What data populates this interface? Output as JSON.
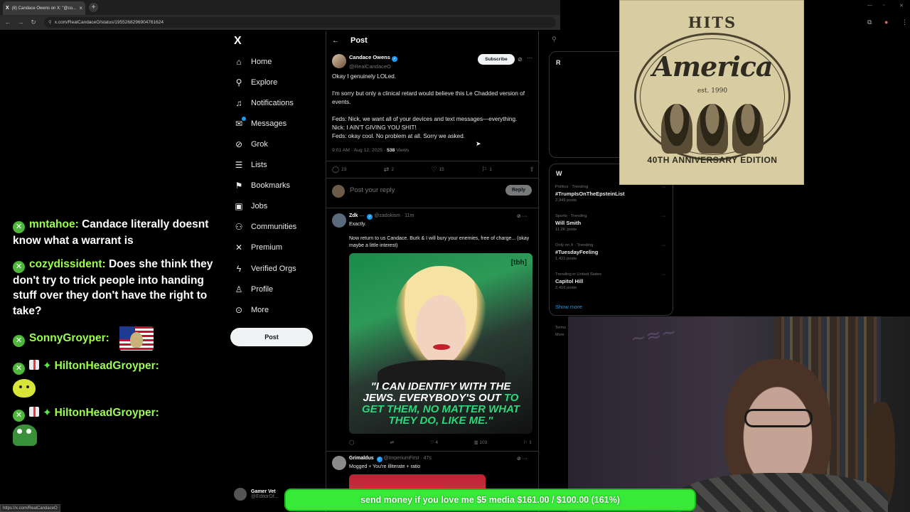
{
  "browser": {
    "tab_title": "(8) Candace Owens on X: \"@co...",
    "url": "x.com/RealCandaceO/status/1955268296904761624"
  },
  "chat": {
    "messages": [
      {
        "user": "mntahoe:",
        "text": "Candace literally doesnt know what a warrant is"
      },
      {
        "user": "cozydissident:",
        "text": "Does she think they don't try to trick people into handing stuff over they don't have the right to take?"
      },
      {
        "user": "SonnyGroyper:",
        "text": ""
      },
      {
        "user": "HiltonHeadGroyper:",
        "text": ""
      },
      {
        "user": "HiltonHeadGroyper:",
        "text": ""
      }
    ]
  },
  "nav": {
    "logo": "X",
    "items": [
      {
        "label": "Home",
        "icon": "home-icon"
      },
      {
        "label": "Explore",
        "icon": "search-icon"
      },
      {
        "label": "Notifications",
        "icon": "bell-icon"
      },
      {
        "label": "Messages",
        "icon": "mail-icon"
      },
      {
        "label": "Grok",
        "icon": "grok-icon"
      },
      {
        "label": "Lists",
        "icon": "list-icon"
      },
      {
        "label": "Bookmarks",
        "icon": "bookmark-icon"
      },
      {
        "label": "Jobs",
        "icon": "briefcase-icon"
      },
      {
        "label": "Communities",
        "icon": "people-icon"
      },
      {
        "label": "Premium",
        "icon": "x-icon"
      },
      {
        "label": "Verified Orgs",
        "icon": "lightning-icon"
      },
      {
        "label": "Profile",
        "icon": "person-icon"
      },
      {
        "label": "More",
        "icon": "more-circle-icon"
      }
    ],
    "post_button": "Post",
    "account": {
      "name": "Gamer Vet",
      "handle": "@EditorOf..."
    }
  },
  "post": {
    "header": "Post",
    "author": "Candace Owens",
    "handle": "@RealCandaceO",
    "subscribe": "Subscribe",
    "paragraphs": [
      "Okay I genuinely LOLed.",
      "I'm sorry but only a clinical retard would believe this Le Chadded version of events."
    ],
    "dialogue": [
      "Feds: Nick, we want all of your devices and text messages—everything.",
      "Nick: I AIN'T GIVING YOU SHIT!",
      "Feds: okay cool. No problem at all. Sorry we asked."
    ],
    "time": "9:01 AM · Aug 12, 2025 ·",
    "views_count": "538",
    "views_label": "Views",
    "stats": {
      "replies": "23",
      "reposts": "2",
      "likes": "15",
      "bookmarks": "1"
    }
  },
  "reply_box": {
    "placeholder": "Post your reply",
    "button": "Reply"
  },
  "replies": [
    {
      "name": "Zdk",
      "handle": "@zadokism · 11m",
      "text": "Exactly.",
      "text2": "Now return to us Candace. Burk & I will bury your enemies, free of charge... (okay maybe a little interest)",
      "image": {
        "tag": "[tbh]",
        "quote_white": "\"I CAN IDENTIFY WITH THE JEWS. EVERYBODY'S OUT",
        "quote_green": "TO GET THEM, NO MATTER WHAT THEY DO, LIKE ME.\""
      },
      "stats": {
        "likes": "4",
        "views": "103"
      }
    },
    {
      "name": "Grimaldus",
      "handle": "@ImperiumFirst · 47s",
      "text": "Mogged + You're illiterate + ratio"
    }
  ],
  "sidebar": {
    "card1_letter": "R",
    "card2_letter": "W",
    "trends": [
      {
        "category": "Politics · Trending",
        "name": "#TrumpIsOnTheEpsteinList",
        "posts": "2,949 posts"
      },
      {
        "category": "Sports · Trending",
        "name": "Will Smith",
        "posts": "11.2K posts"
      },
      {
        "category": "Only on X · Trending",
        "name": "#TuesdayFeeling",
        "posts": "1,421 posts"
      },
      {
        "category": "Trending in United States",
        "name": "Capitol Hill",
        "posts": "2,416 posts"
      }
    ],
    "show_more": "Show more",
    "footer": [
      "Terms",
      "More"
    ]
  },
  "album": {
    "top": "HITS",
    "title": "America",
    "est": "est. 1990",
    "bottom": "40TH ANNIVERSARY EDITION"
  },
  "donation": {
    "text": "send money if you love me $5 media $161.00 / $100.00 (161%)",
    "progress": 1.0,
    "color": "#2bd62b"
  },
  "status_bar": {
    "url": "https://x.com/RealCandaceO"
  },
  "colors": {
    "accent": "#1d9bf0",
    "chat_name": "#9cff4d",
    "background": "#000000"
  }
}
